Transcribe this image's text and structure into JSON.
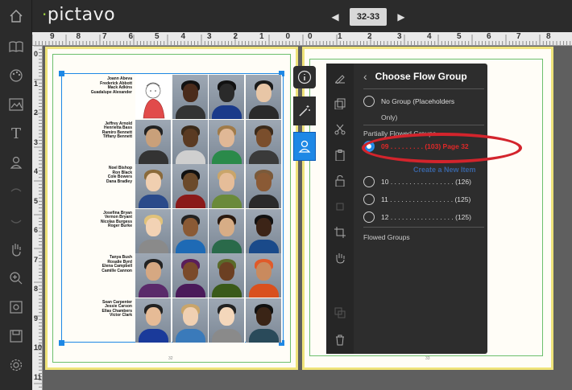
{
  "app": {
    "logo": "pictavo",
    "page_range": "32-33"
  },
  "ruler": {
    "h_left": [
      "9",
      "8",
      "7",
      "6",
      "5",
      "4",
      "3",
      "2",
      "1",
      "0"
    ],
    "h_right": [
      "0",
      "1",
      "2",
      "3",
      "4",
      "5",
      "6",
      "7",
      "8",
      "9"
    ],
    "v": [
      "0",
      "1",
      "2",
      "3",
      "4",
      "5",
      "6",
      "7",
      "8",
      "9",
      "10",
      "11"
    ]
  },
  "page_numbers": {
    "left": "32",
    "right": "33"
  },
  "rows": [
    {
      "names": [
        "Joann Abeva",
        "Frederick Abbott",
        "Mack Adkins",
        "Guadalupe Alexander"
      ]
    },
    {
      "names": [
        "Jeffrey Arnold",
        "Henrietta Bass",
        "Ramiro Bennett",
        "Tiffany Bennett"
      ]
    },
    {
      "names": [
        "Noel Bishop",
        "Ron Black",
        "Cole Bowers",
        "Dana Bradley"
      ]
    },
    {
      "names": [
        "Josefina Bryan",
        "Vernon Bryant",
        "Nicolas Burgess",
        "Roger Burke"
      ]
    },
    {
      "names": [
        "Tanya Bush",
        "Rosalie Byrd",
        "Elena Campbell",
        "Camille Cannon"
      ]
    },
    {
      "names": [
        "Sean Carpenter",
        "Jessie Carson",
        "Ellas Chambers",
        "Victor Clark"
      ]
    }
  ],
  "panel": {
    "title": "Choose Flow Group",
    "no_group_label": "No Group (Placeholders",
    "no_group_label_2": "Only)",
    "partially_flowed_label": "Partially Flowed Groups",
    "selected_option": "09 . . . . . . . . .  (103)  Page 32",
    "ghost_text": "Create a New Item",
    "options": [
      "10 . . . . . . . . . . . . . . . . . (126)",
      "11 . . . . . . . . . . . . . . . . . (125)",
      "12 . . . . . . . . . . . . . . . . . (125)"
    ],
    "flowed_label": "Flowed Groups"
  },
  "colors": {
    "accent": "#1e88e5",
    "highlight": "#d3242c",
    "page_border": "#efe37a",
    "brand_dot": "#9ccf3c"
  }
}
